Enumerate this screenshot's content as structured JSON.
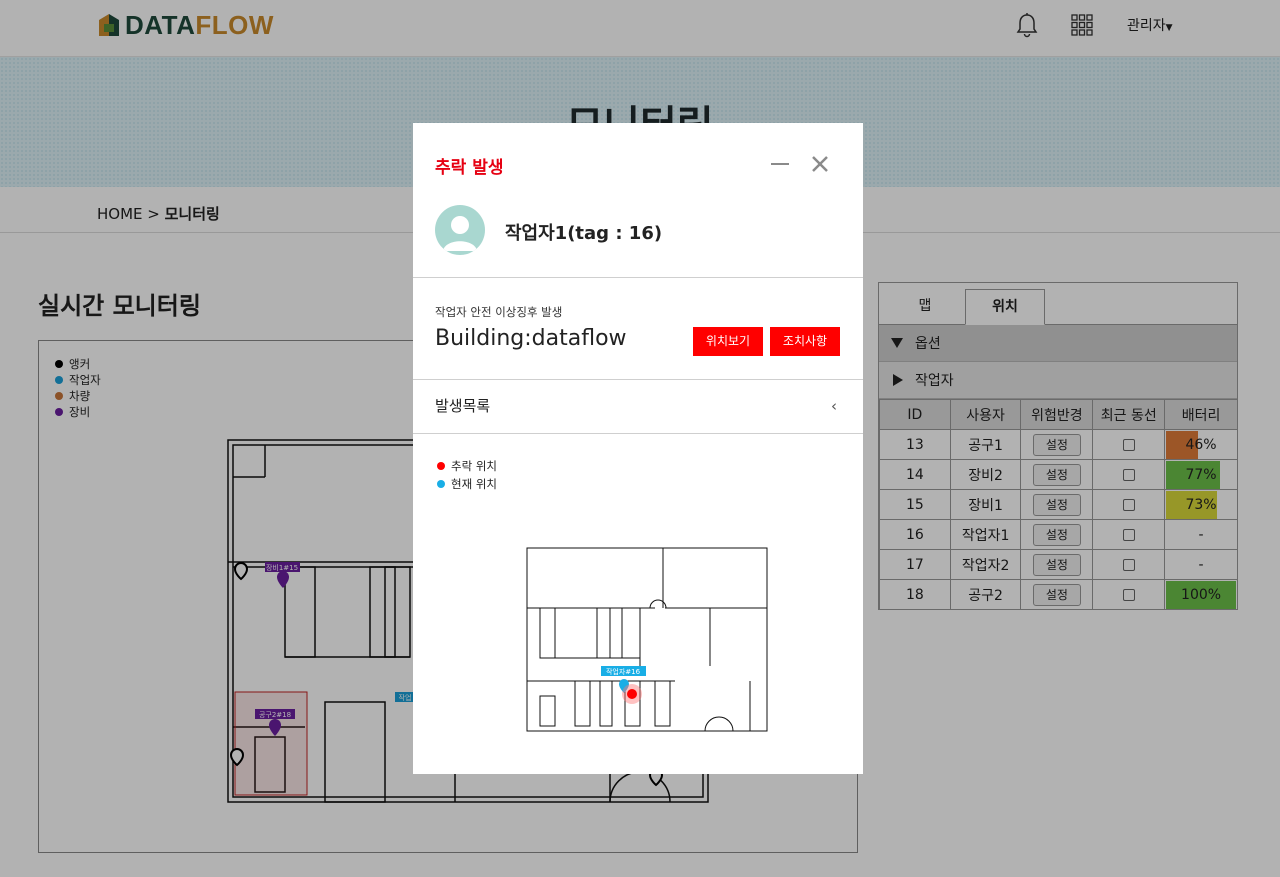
{
  "header": {
    "logo_part1": "DATA",
    "logo_part2": "FLOW",
    "admin_label": "관리자"
  },
  "hero": {
    "title": "모니터링"
  },
  "breadcrumb": {
    "home": "HOME",
    "separator": " > ",
    "current": "모니터링"
  },
  "main": {
    "title": "실시간 모니터링"
  },
  "map": {
    "legend": [
      {
        "label": "앵커",
        "color": "#000000"
      },
      {
        "label": "작업자",
        "color": "#1aa0d8"
      },
      {
        "label": "차량",
        "color": "#c8763a"
      },
      {
        "label": "장비",
        "color": "#6a1fa0"
      }
    ],
    "markers": {
      "equipment": "장비1#15",
      "tool": "공구2#18",
      "worker": "작업"
    }
  },
  "panel": {
    "tabs": [
      "맵",
      "위치"
    ],
    "active_tab": "위치",
    "sections": [
      "옵션",
      "작업자"
    ],
    "columns": [
      "ID",
      "사용자",
      "위험반경",
      "최근 동선",
      "배터리"
    ],
    "rows": [
      {
        "id": "13",
        "user": "공구1",
        "radius": "설정",
        "battery": "46%",
        "battery_level": 0.46,
        "battery_color": "#e07b39"
      },
      {
        "id": "14",
        "user": "장비2",
        "radius": "설정",
        "battery": "77%",
        "battery_level": 0.77,
        "battery_color": "#6cc04a"
      },
      {
        "id": "15",
        "user": "장비1",
        "radius": "설정",
        "battery": "73%",
        "battery_level": 0.73,
        "battery_color": "#d9d93a"
      },
      {
        "id": "16",
        "user": "작업자1",
        "radius": "설정",
        "battery": "-",
        "battery_level": 0,
        "battery_color": "#ffffff"
      },
      {
        "id": "17",
        "user": "작업자2",
        "radius": "설정",
        "battery": "-",
        "battery_level": 0,
        "battery_color": "#ffffff"
      },
      {
        "id": "18",
        "user": "공구2",
        "radius": "설정",
        "battery": "100%",
        "battery_level": 1.0,
        "battery_color": "#6cc04a"
      }
    ]
  },
  "modal": {
    "title": "추락 발생",
    "worker": "작업자1(tag : 16)",
    "event_subtitle": "작업자 안전 이상징후 발생",
    "building": "Building:dataflow",
    "btn_view_location": "위치보기",
    "btn_actions": "조치사항",
    "history_label": "발생목록",
    "legend": [
      {
        "label": "추락 위치",
        "color": "#ff0000"
      },
      {
        "label": "현재 위치",
        "color": "#19aee6"
      }
    ],
    "minimap_tag": "작업자#16",
    "accent_color": "#e60012"
  }
}
